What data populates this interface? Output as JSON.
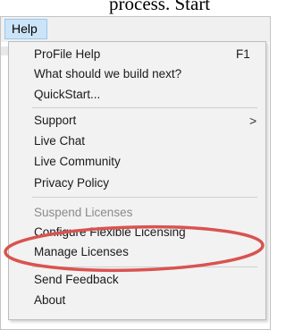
{
  "document": {
    "fragment": "process. Start"
  },
  "menubar": {
    "help_label": "Help"
  },
  "menu": {
    "items": [
      {
        "label": "ProFile Help",
        "shortcut": "F1"
      },
      {
        "label": "What should we build next?"
      },
      {
        "label": "QuickStart..."
      },
      {
        "label": "Support",
        "submenu": true
      },
      {
        "label": "Live Chat"
      },
      {
        "label": "Live Community"
      },
      {
        "label": "Privacy Policy"
      },
      {
        "label": "Suspend Licenses",
        "disabled": true
      },
      {
        "label": "Configure Flexible Licensing"
      },
      {
        "label": "Manage Licenses",
        "highlighted": true
      },
      {
        "label": "Send Feedback"
      },
      {
        "label": "About"
      }
    ],
    "submenu_arrow": ">"
  },
  "annotation": {
    "ellipse_color": "#d9534f",
    "target": "Manage Licenses"
  },
  "colors": {
    "menu_bg": "#f2f2f2",
    "menubar_active": "#cce4f7",
    "disabled_text": "#8a8a8a"
  }
}
